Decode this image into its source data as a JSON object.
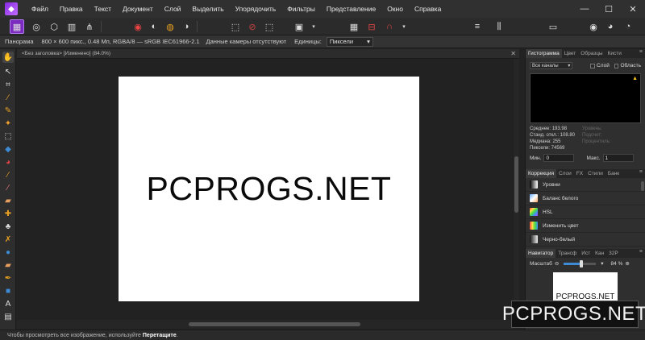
{
  "menu": {
    "items": [
      "Файл",
      "Правка",
      "Текст",
      "Документ",
      "Слой",
      "Выделить",
      "Упорядочить",
      "Фильтры",
      "Представление",
      "Окно",
      "Справка"
    ]
  },
  "window_controls": {
    "minimize": "—",
    "maximize": "☐",
    "close": "✕"
  },
  "context_bar": {
    "tool_label": "Панорама",
    "doc_info": "800 × 600 пикс., 0.48 Мп, RGBA/8 — sRGB IEC61966-2.1",
    "camera_info": "Данные камеры отсутствуют",
    "units_label": "Единицы:",
    "units_value": "Пиксели"
  },
  "document": {
    "tab_title": "<Без заголовка> [Изменено] (84.0%)",
    "canvas_text": "PCPROGS.NET"
  },
  "status_bar": {
    "text": "Чтобы просмотреть все изображение, используйте",
    "bold": "Перетащите",
    "end": "."
  },
  "histogram_panel": {
    "tabs": [
      "Гистограмма",
      "Цвет",
      "Образцы",
      "Кисти"
    ],
    "active_tab": 0,
    "channel_select": "Все каналы",
    "layer_label": "Слой",
    "area_label": "Область",
    "stats_left": [
      "Среднее: 193.98",
      "Станд. откл.: 108.80",
      "Медиана: 255",
      "Пиксели: 74569"
    ],
    "stats_right": [
      "Уровень:",
      "Подсчет:",
      "Процентиль:"
    ],
    "min_label": "Мин.",
    "min_value": "0",
    "max_label": "Макс.",
    "max_value": "1"
  },
  "adjustment_panel": {
    "tabs": [
      "Коррекция",
      "Слои",
      "FX",
      "Стили",
      "Банк"
    ],
    "active_tab": 0,
    "items": [
      "Уровни",
      "Баланс белого",
      "HSL",
      "Изменить цвет",
      "Черно-белый"
    ]
  },
  "navigator_panel": {
    "tabs": [
      "Навигатор",
      "Трансф",
      "Ист",
      "Кан",
      "32P"
    ],
    "active_tab": 0,
    "zoom_label": "Масштаб",
    "zoom_value": "84 %",
    "zoom_fraction": 0.55,
    "preview_text": "PCPROGS.NET"
  },
  "watermark": "PCPROGS.NET",
  "colors": {
    "accent": "#7b2cbf",
    "selection_blue": "#3d8bd4",
    "warning": "#f0c020"
  }
}
